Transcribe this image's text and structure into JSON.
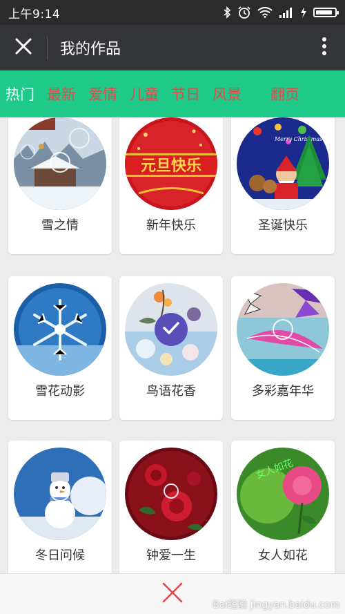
{
  "status_bar": {
    "time": "上午9:14",
    "icons": [
      "bluetooth-icon",
      "alarm-icon",
      "wifi-icon",
      "signal-icon",
      "battery-icon"
    ],
    "battery_level": 0.9
  },
  "header": {
    "title": "我的作品",
    "close_icon": "close-icon",
    "more_icon": "more-vertical-icon"
  },
  "categories": [
    {
      "label": "热门",
      "active": true
    },
    {
      "label": "最新",
      "active": false
    },
    {
      "label": "爱情",
      "active": false
    },
    {
      "label": "儿童",
      "active": false
    },
    {
      "label": "节日",
      "active": false
    },
    {
      "label": "风景",
      "active": false
    }
  ],
  "paging_label": "翻页",
  "cards": [
    {
      "label": "雪之情",
      "image": "snow-cabin"
    },
    {
      "label": "新年快乐",
      "image": "new-year",
      "image_text": "元旦快乐"
    },
    {
      "label": "圣诞快乐",
      "image": "christmas",
      "image_text": "Merry Christmas"
    },
    {
      "label": "雪花动影",
      "image": "snowflake"
    },
    {
      "label": "鸟语花香",
      "image": "birds-flowers",
      "selected": true
    },
    {
      "label": "多彩嘉年华",
      "image": "butterflies"
    },
    {
      "label": "冬日问候",
      "image": "snowman"
    },
    {
      "label": "钟爱一生",
      "image": "roses"
    },
    {
      "label": "女人如花",
      "image": "pink-rose",
      "image_text": "女人如花"
    }
  ],
  "colors": {
    "category_bar": "#1ec98a",
    "tab_inactive": "#e34a4a",
    "tab_active": "#ffffff",
    "title_bar": "#333538",
    "status_bar": "#2b2b2b",
    "check_badge": "#5a4fb8",
    "bottom_close": "#e04848"
  },
  "bottom_bar": {
    "close_icon": "close-icon"
  },
  "watermark": "Bai经验 jingyan.baidu.com"
}
